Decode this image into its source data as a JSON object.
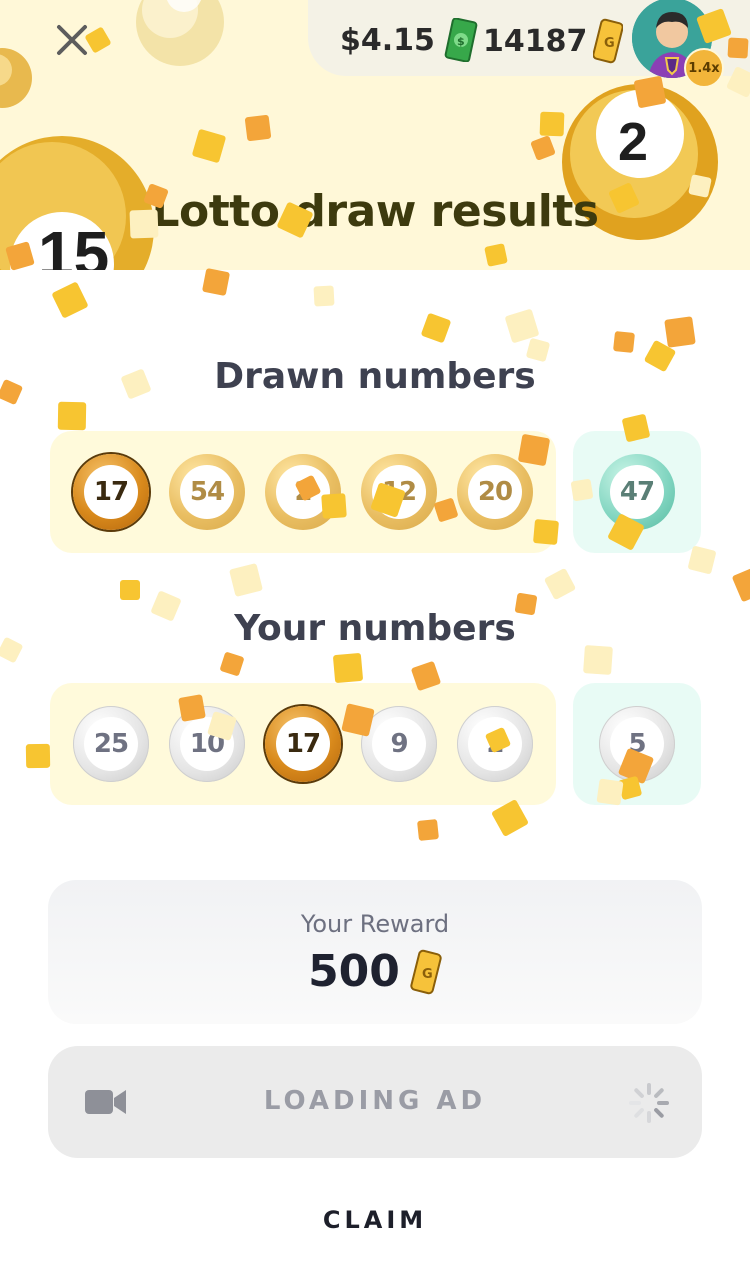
{
  "header": {
    "title": "Lotto draw results",
    "cash": "$4.15",
    "tickets": "14187",
    "multiplier": "1.4x"
  },
  "drawn": {
    "title": "Drawn numbers",
    "numbers": [
      "17",
      "54",
      "2",
      "12",
      "20"
    ],
    "bonus": "47"
  },
  "yours": {
    "title": "Your numbers",
    "numbers": [
      "25",
      "10",
      "17",
      "9",
      "2"
    ],
    "bonus": "5"
  },
  "reward": {
    "label": "Your Reward",
    "value": "500"
  },
  "ad_button": {
    "label": "LOADING AD"
  },
  "claim": {
    "label": "CLAIM"
  },
  "colors": {
    "header_bg": "#fff8d8",
    "row_bg": "#fffadb",
    "bonus_bg": "#e8fbf5",
    "title_text": "#3d3a0e"
  }
}
